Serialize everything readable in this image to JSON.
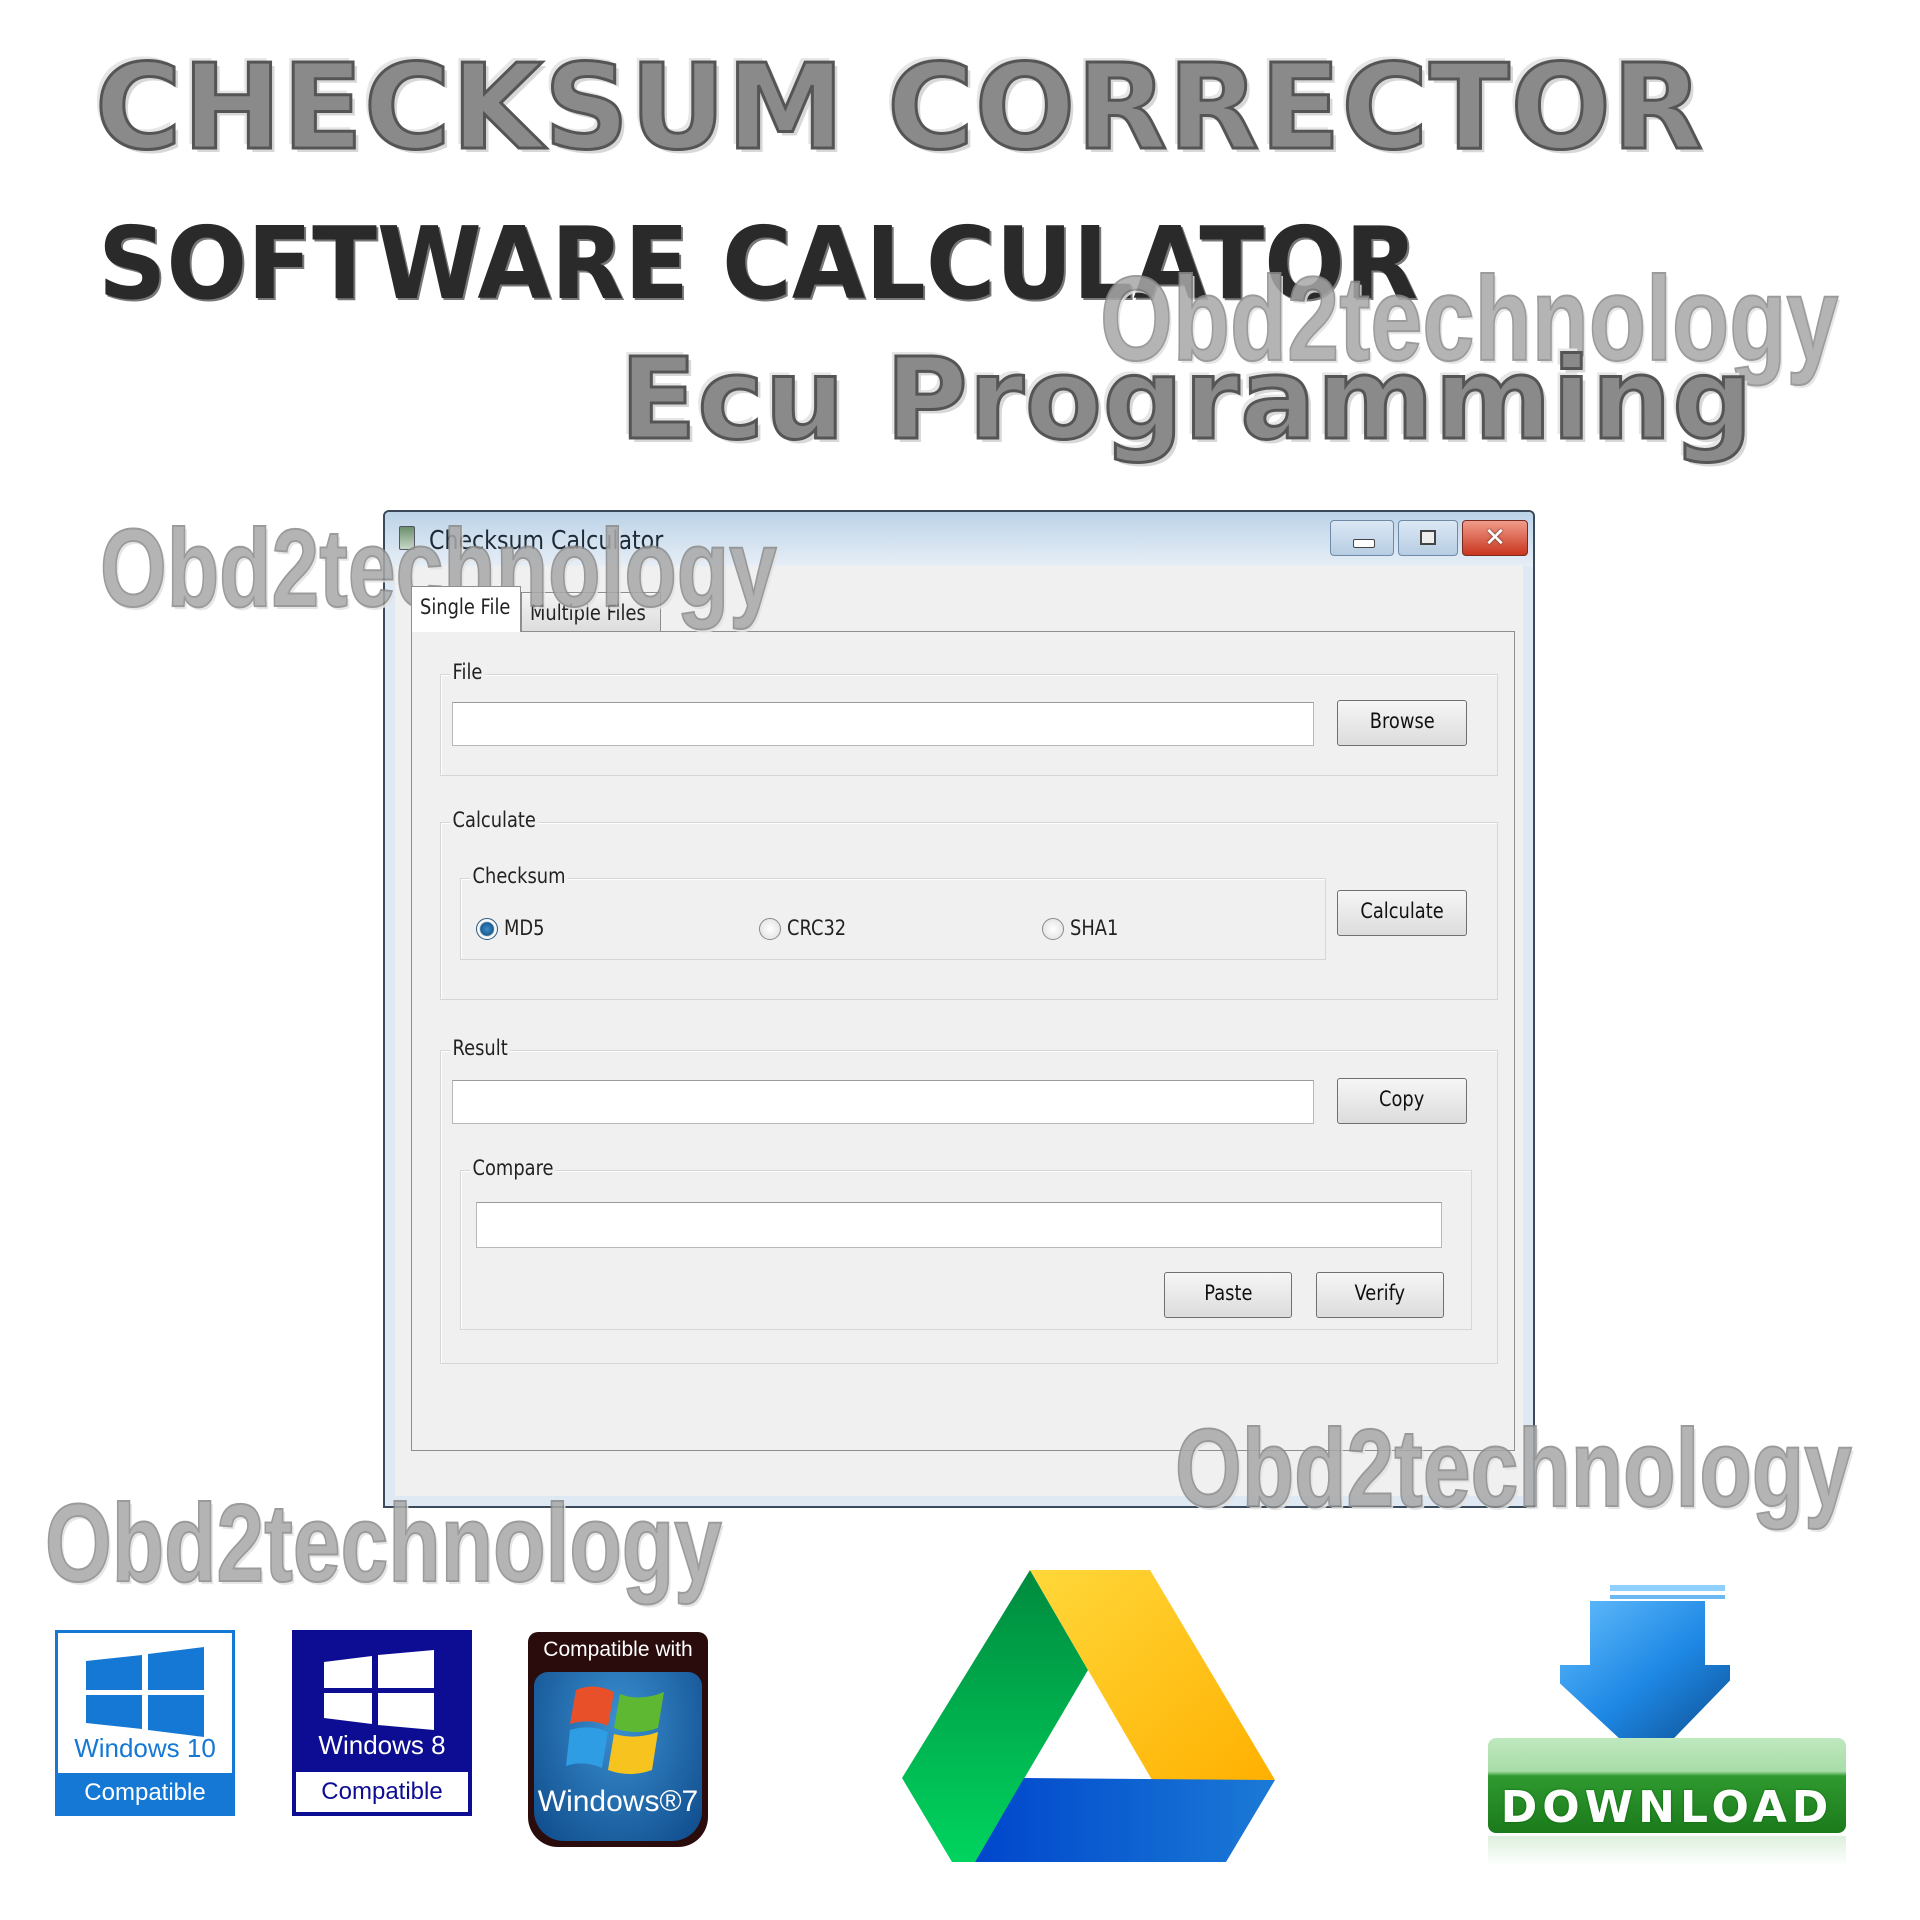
{
  "banner": {
    "line1": "CHECKSUM CORRECTOR",
    "line2": "SOFTWARE CALCULATOR",
    "line3": "Ecu Programming",
    "watermark": "Obd2technology"
  },
  "window": {
    "title": "Checksum Calculator",
    "controls": {
      "minimize": "minimize",
      "maximize": "maximize",
      "close": "✕"
    },
    "tabs": [
      {
        "label": "Single File",
        "active": true
      },
      {
        "label": "Multiple Files",
        "active": false
      }
    ],
    "file_group": {
      "label": "File",
      "input_value": "",
      "browse_label": "Browse"
    },
    "calculate_group": {
      "label": "Calculate",
      "checksum_label": "Checksum",
      "options": [
        {
          "label": "MD5",
          "selected": true
        },
        {
          "label": "CRC32",
          "selected": false
        },
        {
          "label": "SHA1",
          "selected": false
        }
      ],
      "calculate_label": "Calculate"
    },
    "result_group": {
      "label": "Result",
      "input_value": "",
      "copy_label": "Copy",
      "compare_label": "Compare",
      "compare_value": "",
      "paste_label": "Paste",
      "verify_label": "Verify"
    }
  },
  "badges": {
    "win10": {
      "name": "Windows 10",
      "footer": "Compatible",
      "color": "#1478d4"
    },
    "win8": {
      "name": "Windows 8",
      "footer": "Compatible",
      "color": "#0d0d94"
    },
    "win7": {
      "header": "Compatible with",
      "name": "Windows®7"
    },
    "drive": {
      "colors": {
        "green": "#00a84f",
        "yellow": "#ffc107",
        "blue": "#1565d8"
      }
    },
    "download": {
      "label": "DOWNLOAD",
      "arrow_color": "#1e88e5",
      "bar_color": "#2e8b2e"
    }
  }
}
